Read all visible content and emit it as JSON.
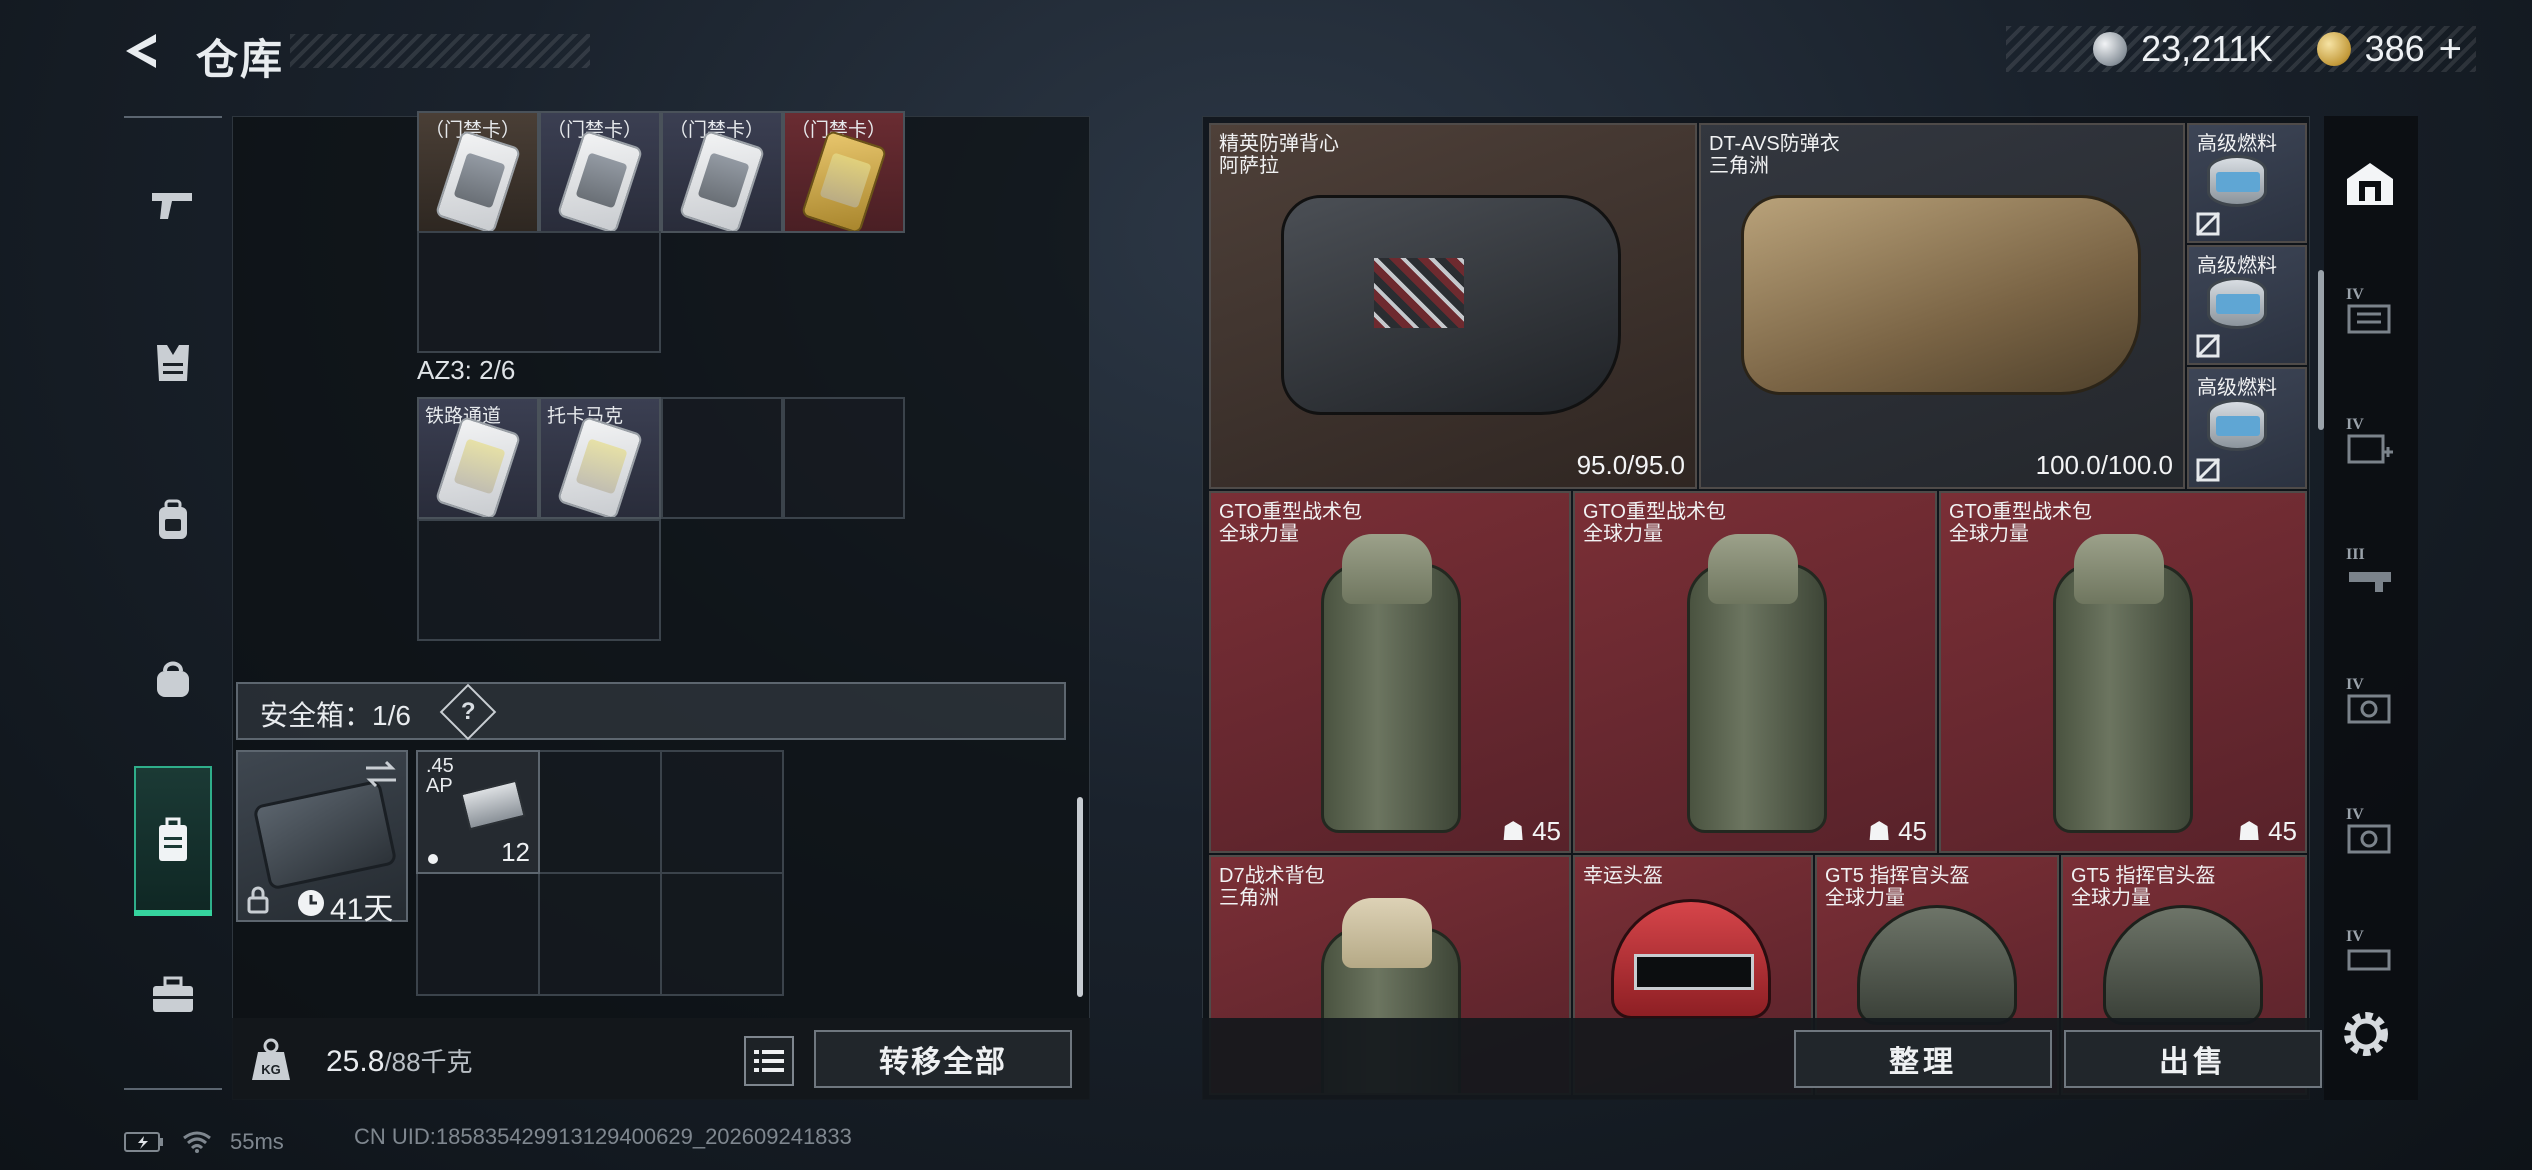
{
  "header": {
    "title": "仓库",
    "currency_1": "23,211K",
    "currency_2": "386",
    "add": "+"
  },
  "left_nav": {
    "items": [
      "gun-icon",
      "armor-icon",
      "backpack-icon",
      "bag-icon",
      "case-icon",
      "toolbox-icon"
    ],
    "active": "case-icon"
  },
  "left_panel": {
    "top_row_labels": [
      "（门禁卡）",
      "（门禁卡）",
      "（门禁卡）",
      "（门禁卡）"
    ],
    "az3_label": "AZ3: 2/6",
    "az3_items": [
      "铁路通道",
      "托卡马克"
    ],
    "safe_label": "安全箱：1/6",
    "safe_help": "?",
    "safe_days": "41天",
    "ammo_name": ".45\nAP",
    "ammo_count": "12"
  },
  "left_bottom": {
    "weight_value": "25.8",
    "weight_max": "/88千克",
    "transfer_all": "转移全部"
  },
  "right_panel": {
    "vest1": {
      "name": "精英防弹背心",
      "origin": "阿萨拉",
      "durability": "95.0/95.0"
    },
    "vest2": {
      "name": "DT-AVS防弹衣",
      "origin": "三角洲",
      "durability": "100.0/100.0"
    },
    "fuel": [
      "高级燃料",
      "高级燃料",
      "高级燃料"
    ],
    "packs": [
      {
        "name": "GTO重型战术包",
        "origin": "全球力量",
        "capacity": "45"
      },
      {
        "name": "GTO重型战术包",
        "origin": "全球力量",
        "capacity": "45"
      },
      {
        "name": "GTO重型战术包",
        "origin": "全球力量",
        "capacity": "45"
      }
    ],
    "row3": [
      {
        "name": "D7战术背包",
        "origin": "三角洲"
      },
      {
        "name": "幸运头盔",
        "origin": ""
      },
      {
        "name": "GT5 指挥官头盔",
        "origin": "全球力量"
      },
      {
        "name": "GT5 指挥官头盔",
        "origin": "全球力量"
      }
    ]
  },
  "right_bottom": {
    "organize": "整理",
    "sell": "出售"
  },
  "right_nav": {
    "tiers": [
      "IV",
      "IV",
      "III",
      "IV",
      "IV",
      "IV"
    ]
  },
  "status": {
    "ping": "55ms",
    "uid": "CN UID:1858354299131294006​29_202609241833"
  },
  "colors": {
    "accent_green": "#35d39e",
    "red_slot": "#7a2f36",
    "brown_slot": "#4e4039"
  }
}
